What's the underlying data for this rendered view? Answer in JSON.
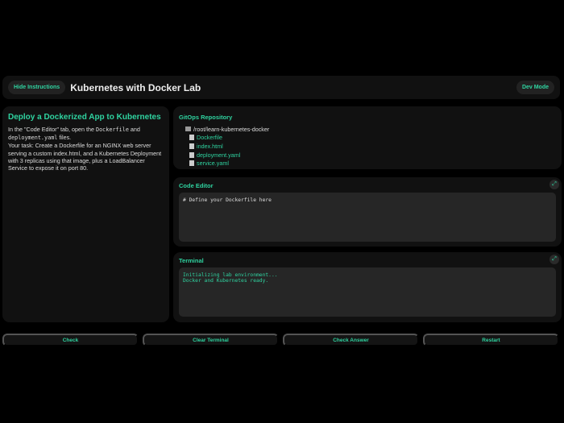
{
  "header": {
    "hide_instructions": "Hide Instructions",
    "title": "Kubernetes with Docker Lab",
    "dev_mode": "Dev Mode"
  },
  "instructions": {
    "title": "Deploy a Dockerized App to Kubernetes",
    "p1_a": "In the \"Code Editor\" tab, open the ",
    "p1_code1": "Dockerfile",
    "p1_b": " and ",
    "p1_code2": "deployment.yaml",
    "p1_c": " files.",
    "p2": "Your task: Create a Dockerfile for an NGINX web server serving a custom index.html, and a Kubernetes Deployment with 3 replicas using that image, plus a LoadBalancer Service to expose it on port 80."
  },
  "repo": {
    "title": "GitOps Repository",
    "root": "/root/learn-kubernetes-docker",
    "files": [
      "Dockerfile",
      "index.html",
      "deployment.yaml",
      "service.yaml"
    ]
  },
  "editor": {
    "title": "Code Editor",
    "content": "# Define your Dockerfile here"
  },
  "terminal": {
    "title": "Terminal",
    "content": "Initializing lab environment...\nDocker and Kubernetes ready."
  },
  "buttons": {
    "check": "Check",
    "clear": "Clear Terminal",
    "check_answer": "Check Answer",
    "restart": "Restart"
  }
}
